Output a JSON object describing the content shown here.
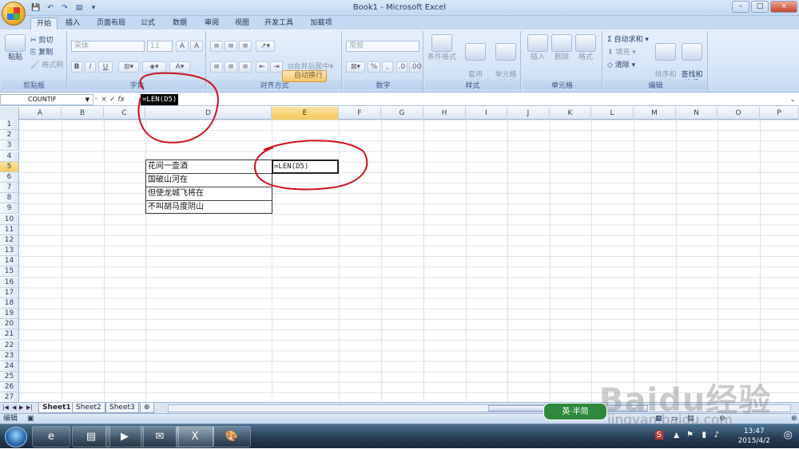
{
  "window": {
    "title": "Book1 - Microsoft Excel",
    "buttons": {
      "minimize": "–",
      "restore": "□",
      "close": "×"
    }
  },
  "tabs": [
    "开始",
    "插入",
    "页面布局",
    "公式",
    "数据",
    "审阅",
    "视图",
    "开发工具",
    "加载项"
  ],
  "ribbon": {
    "clipboard": {
      "paste": "粘贴",
      "cut": "剪切",
      "copy": "复制",
      "format_painter": "格式刷",
      "label": "剪贴板"
    },
    "font": {
      "font_name": "宋体",
      "font_size": "11",
      "bold": "B",
      "italic": "I",
      "underline": "U",
      "label": "字体"
    },
    "alignment": {
      "wrap": "自动换行",
      "merge": "合并后居中",
      "label": "对齐方式"
    },
    "number": {
      "format": "常规",
      "percent": "%",
      "comma": ",",
      "label": "数字"
    },
    "styles": {
      "conditional": "条件格式",
      "table_format": "套用\n表格格式",
      "cell_styles": "单元格\n样式",
      "label": "样式"
    },
    "cells": {
      "insert": "插入",
      "delete": "删除",
      "format": "格式",
      "label": "单元格"
    },
    "editing": {
      "autosum": "Σ 自动求和",
      "fill": "填充",
      "clear": "清除",
      "sort": "排序和\n筛选",
      "find": "查找和\n选择",
      "label": "编辑"
    }
  },
  "formula_bar": {
    "name_box": "COUNTIF",
    "cancel": "×",
    "enter": "✓",
    "fx": "fx",
    "formula": "=LEN(D5)"
  },
  "columns": [
    "A",
    "B",
    "C",
    "D",
    "E",
    "F",
    "G",
    "H",
    "I",
    "J",
    "K",
    "L",
    "M",
    "N",
    "O",
    "P"
  ],
  "selected_column": "E",
  "rows": [
    "1",
    "2",
    "3",
    "4",
    "5",
    "6",
    "7",
    "8",
    "9",
    "10",
    "11",
    "12",
    "13",
    "14",
    "15",
    "16",
    "17",
    "18",
    "19",
    "20",
    "21",
    "22",
    "23",
    "24",
    "25",
    "26",
    "27"
  ],
  "selected_row": "5",
  "cells": {
    "D5": "花间一壶酒",
    "D6": "国破山河在",
    "D7": "但使龙城飞将在",
    "D8": "不叫胡马度阴山",
    "E5": "=LEN(D5)"
  },
  "sheets": {
    "tabs": [
      "Sheet1",
      "Sheet2",
      "Sheet3"
    ],
    "active": "Sheet1"
  },
  "status": {
    "mode": "编辑"
  },
  "taskbar": {
    "time": "13:47",
    "date": "2015/4/2"
  },
  "watermark": {
    "brand": "Baidu经验",
    "url": "jingyan.baidu.com",
    "badge": "英·半简"
  },
  "annotation_color": "#d0101e",
  "accent_colors": {
    "selected_header": "#f7c85c",
    "ribbon": "#d3e3f7"
  }
}
